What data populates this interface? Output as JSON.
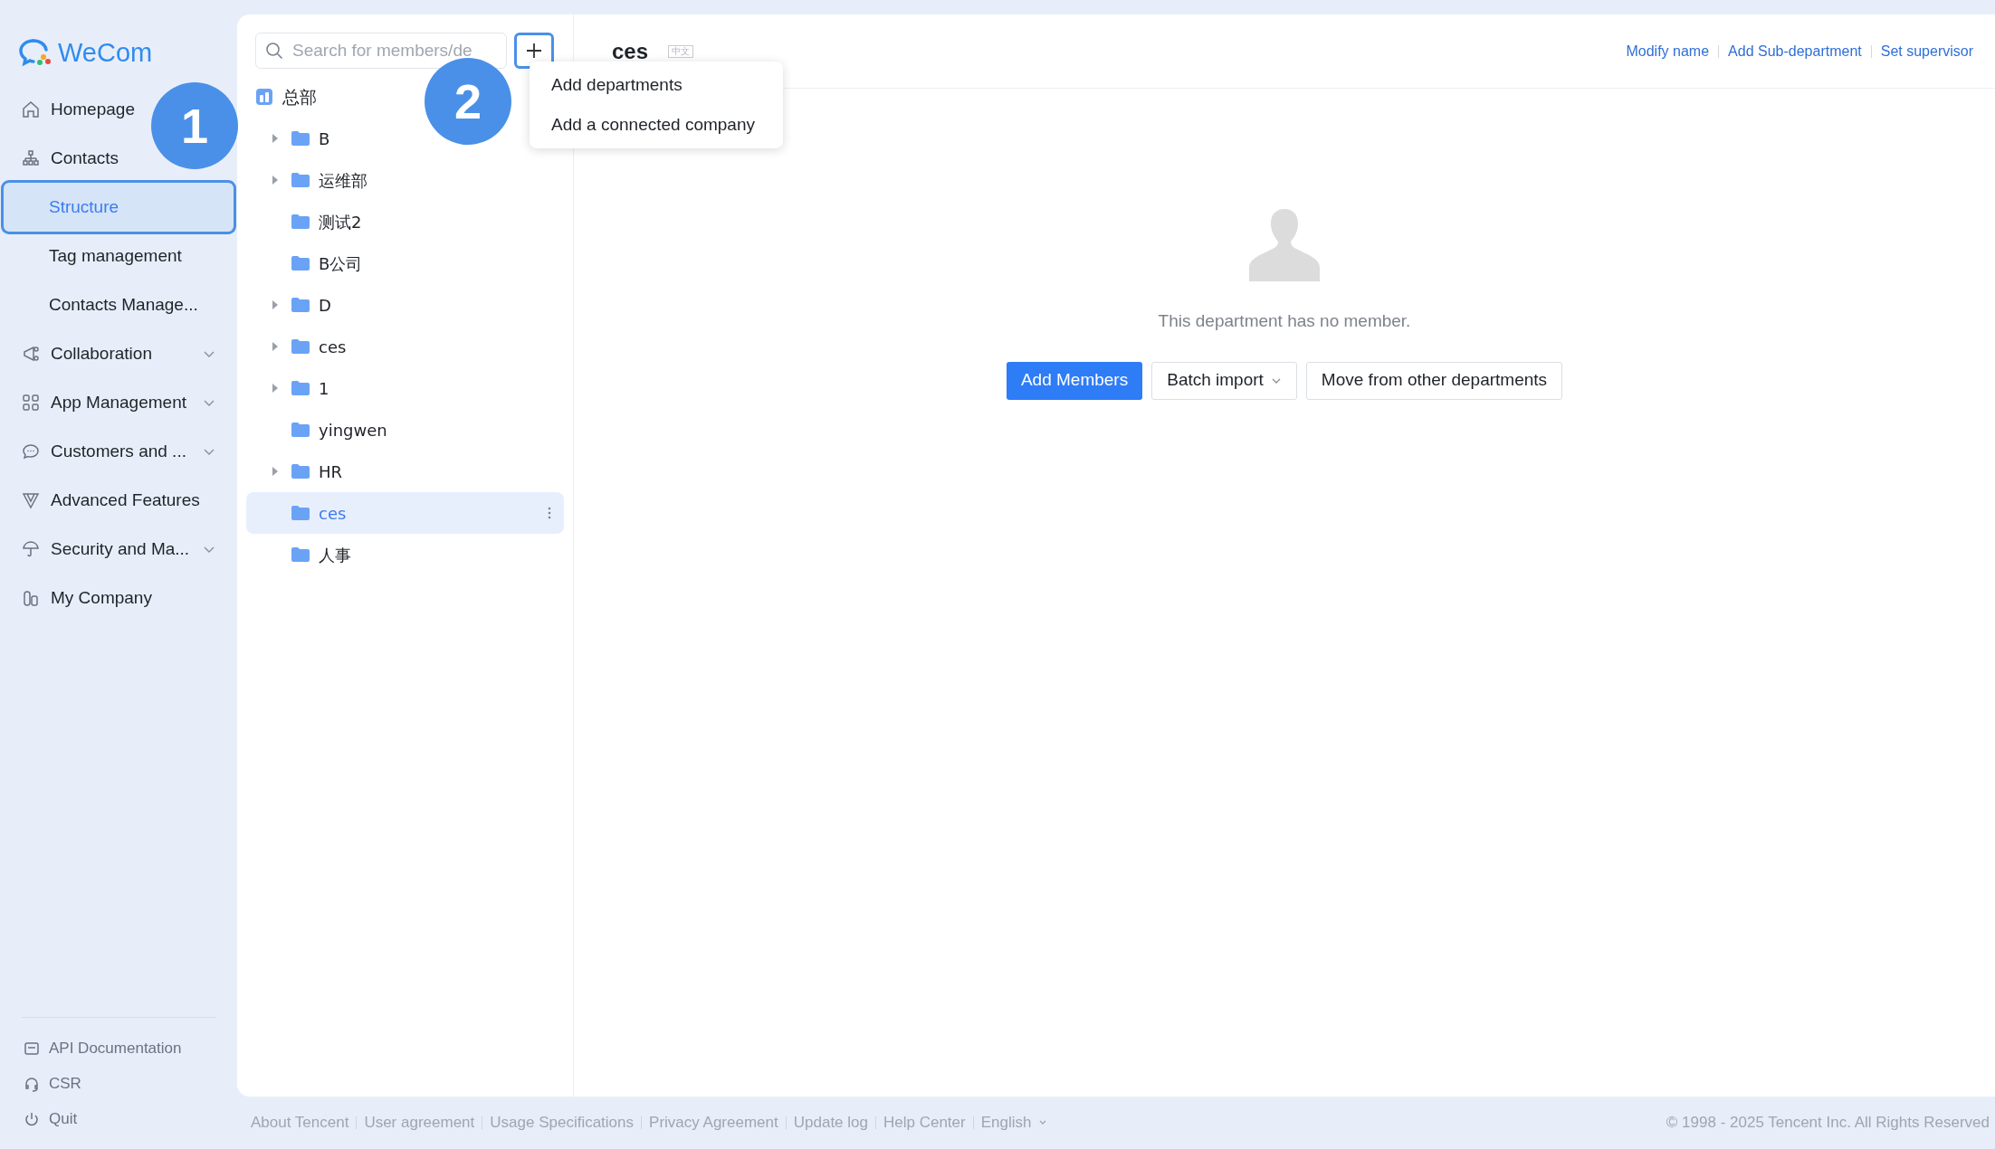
{
  "brand": "WeCom",
  "nav": [
    {
      "label": "Homepage",
      "selected": false
    },
    {
      "label": "Contacts",
      "selected": false,
      "children": [
        {
          "label": "Structure",
          "selected": true
        },
        {
          "label": "Tag management",
          "selected": false
        },
        {
          "label": "Contacts Manage...",
          "selected": false
        }
      ]
    },
    {
      "label": "Collaboration",
      "selected": false,
      "expanded": false
    },
    {
      "label": "App Management",
      "selected": false,
      "expanded": false
    },
    {
      "label": "Customers and ...",
      "selected": false,
      "expanded": false
    },
    {
      "label": "Advanced Features",
      "selected": false
    },
    {
      "label": "Security and Ma...",
      "selected": false,
      "expanded": false
    },
    {
      "label": "My Company",
      "selected": false
    }
  ],
  "sidebar_footer": [
    "API Documentation",
    "CSR",
    "Quit"
  ],
  "search": {
    "placeholder": "Search for members/de"
  },
  "add_menu": [
    "Add departments",
    "Add a connected company"
  ],
  "tree": {
    "label": "总部",
    "children": [
      {
        "label": "B",
        "expandable": true,
        "selected": false
      },
      {
        "label": "运维部",
        "expandable": true,
        "selected": false
      },
      {
        "label": "测试2",
        "expandable": false,
        "selected": false
      },
      {
        "label": "B公司",
        "expandable": false,
        "selected": false
      },
      {
        "label": "D",
        "expandable": true,
        "selected": false
      },
      {
        "label": "ces",
        "expandable": true,
        "selected": false
      },
      {
        "label": "1",
        "expandable": true,
        "selected": false
      },
      {
        "label": "yingwen",
        "expandable": false,
        "selected": false
      },
      {
        "label": "HR",
        "expandable": true,
        "selected": false
      },
      {
        "label": "ces",
        "expandable": false,
        "selected": true
      },
      {
        "label": "人事",
        "expandable": false,
        "selected": false
      }
    ]
  },
  "department": {
    "title": "ces",
    "tag": "中文",
    "actions": [
      "Modify name",
      "Add Sub-department",
      "Set supervisor"
    ],
    "empty_message": "This department has no member.",
    "buttons": [
      {
        "label": "Add Members",
        "kind": "primary"
      },
      {
        "label": "Batch import",
        "kind": "dropdown"
      },
      {
        "label": "Move from other departments",
        "kind": "plain"
      }
    ]
  },
  "footer_links": [
    "About Tencent",
    "User agreement",
    "Usage Specifications",
    "Privacy Agreement",
    "Update log",
    "Help Center",
    "English"
  ],
  "copyright": "© 1998 - 2025 Tencent Inc. All Rights Reserved",
  "callouts": [
    "1",
    "2"
  ]
}
